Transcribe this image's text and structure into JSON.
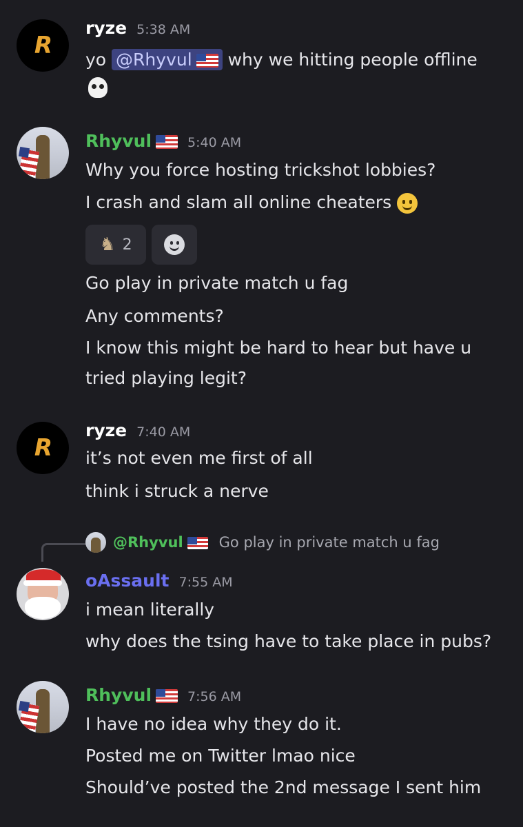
{
  "messages": [
    {
      "username": "ryze",
      "timestamp": "5:38 AM",
      "line_prefix": "yo",
      "mention": "@Rhyvul",
      "line_suffix": "why we hitting people offline",
      "emoji": "skull-icon"
    },
    {
      "username": "Rhyvul",
      "timestamp": "5:40 AM",
      "lines": [
        "Why you force hosting trickshot lobbies?",
        "I crash and slam all online cheaters"
      ],
      "reactions": [
        {
          "emoji": "goat-icon",
          "count": "2"
        },
        {
          "emoji": "add-reaction-icon"
        }
      ],
      "lines_after": [
        "Go play in private match u fag",
        "Any comments?",
        "I know this might be hard to hear but have u",
        "tried playing legit?"
      ]
    },
    {
      "username": "ryze",
      "timestamp": "7:40 AM",
      "lines": [
        "it’s not even me first of all",
        "think i struck a nerve"
      ]
    },
    {
      "reply_to": {
        "username": "@Rhyvul",
        "text": "Go play in private match u fag"
      },
      "username": "oAssault",
      "timestamp": "7:55 AM",
      "lines": [
        "i mean literally",
        "why does the tsing have to take place in pubs?"
      ]
    },
    {
      "username": "Rhyvul",
      "timestamp": "7:56 AM",
      "lines": [
        "I have no idea why they do it.",
        "Posted me on Twitter lmao nice",
        "Should’ve posted the 2nd message I sent him"
      ]
    }
  ],
  "colors": {
    "background": "#1c1c21",
    "ryze_name": "#ffffff",
    "rhyvul_name": "#4fbf5b",
    "oassault_name": "#6a6ff0",
    "mention_bg": "#3d4380"
  },
  "avatars": {
    "ryze": "ryze-logo-icon",
    "rhyvul": "rhyvul-avatar",
    "oassault": "santa-avatar"
  }
}
